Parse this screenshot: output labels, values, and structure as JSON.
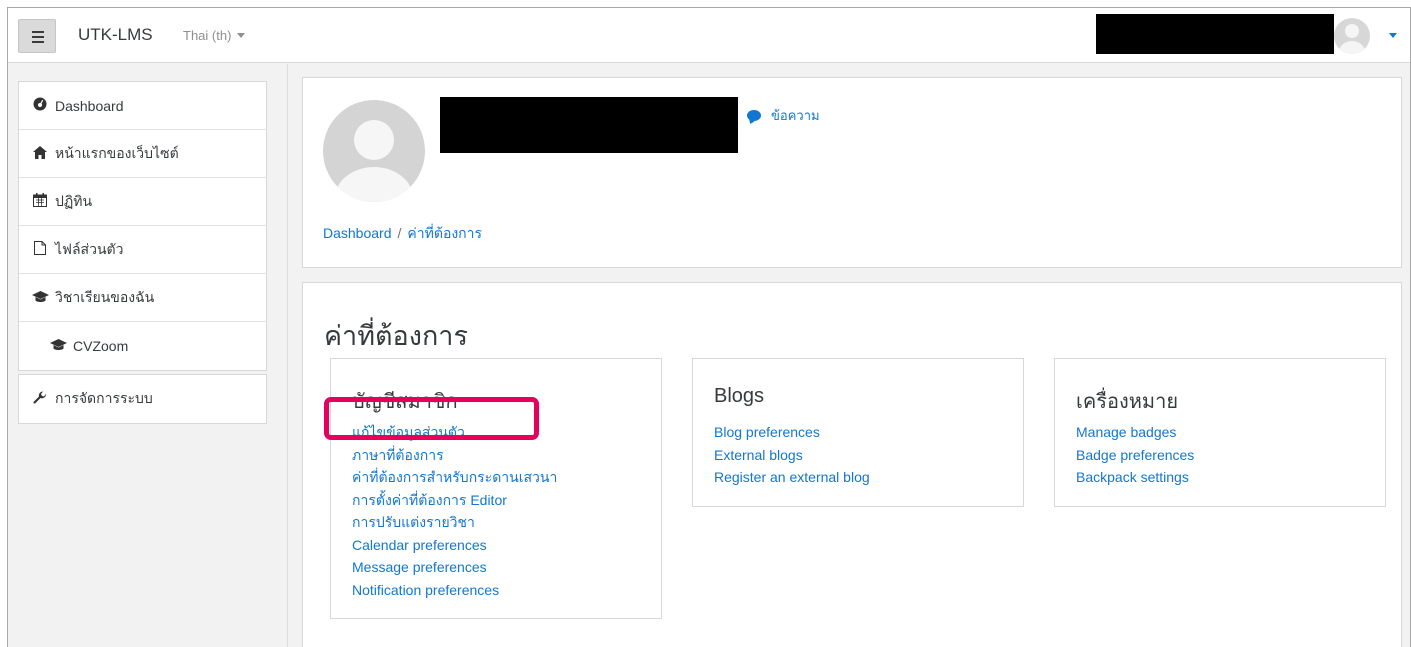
{
  "navbar": {
    "brand": "UTK-LMS",
    "language": "Thai (th)"
  },
  "sidebar": {
    "items": [
      {
        "label": "Dashboard",
        "icon": "dashboard-icon"
      },
      {
        "label": "หน้าแรกของเว็บไซต์",
        "icon": "home-icon"
      },
      {
        "label": "ปฏิทิน",
        "icon": "calendar-icon"
      },
      {
        "label": "ไฟล์ส่วนตัว",
        "icon": "file-icon"
      },
      {
        "label": "วิชาเรียนของฉัน",
        "icon": "graduation-cap-icon"
      },
      {
        "label": "CVZoom",
        "icon": "graduation-cap-icon"
      }
    ],
    "admin": {
      "label": "การจัดการระบบ",
      "icon": "wrench-icon"
    }
  },
  "header": {
    "message_link": "ข้อความ",
    "breadcrumb": [
      "Dashboard",
      "ค่าที่ต้องการ"
    ]
  },
  "main": {
    "title": "ค่าที่ต้องการ",
    "sections": [
      {
        "title": "บัญชีสมาชิก",
        "links": [
          "แก้ไขข้อมูลส่วนตัว",
          "ภาษาที่ต้องการ",
          "ค่าที่ต้องการสำหรับกระดานเสวนา",
          "การตั้งค่าที่ต้องการ Editor",
          "การปรับแต่งรายวิชา",
          "Calendar preferences",
          "Message preferences",
          "Notification preferences"
        ]
      },
      {
        "title": "Blogs",
        "links": [
          "Blog preferences",
          "External blogs",
          "Register an external blog"
        ]
      },
      {
        "title": "เครื่องหมาย",
        "links": [
          "Manage badges",
          "Badge preferences",
          "Backpack settings"
        ]
      }
    ]
  },
  "colors": {
    "link": "#1177d1",
    "highlight": "#e6005c",
    "background": "#f2f2f2"
  }
}
